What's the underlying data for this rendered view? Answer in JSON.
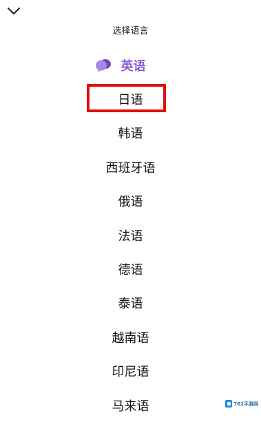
{
  "header": {
    "collapse_icon": "chevron-down-icon",
    "title": "选择语言"
  },
  "languages": [
    {
      "label": "英语",
      "selected": true
    },
    {
      "label": "日语",
      "selected": false
    },
    {
      "label": "韩语",
      "selected": false
    },
    {
      "label": "西班牙语",
      "selected": false
    },
    {
      "label": "俄语",
      "selected": false
    },
    {
      "label": "法语",
      "selected": false
    },
    {
      "label": "德语",
      "selected": false
    },
    {
      "label": "泰语",
      "selected": false
    },
    {
      "label": "越南语",
      "selected": false
    },
    {
      "label": "印尼语",
      "selected": false
    },
    {
      "label": "马来语",
      "selected": false
    }
  ],
  "selection_icon": "speech-bubbles-icon",
  "highlighted_item": "日语",
  "watermark": {
    "text": "762手游网"
  },
  "colors": {
    "selected_text": "#8a5cd6",
    "highlight_border": "#e0100f",
    "text": "#111111",
    "background": "#ffffff"
  }
}
